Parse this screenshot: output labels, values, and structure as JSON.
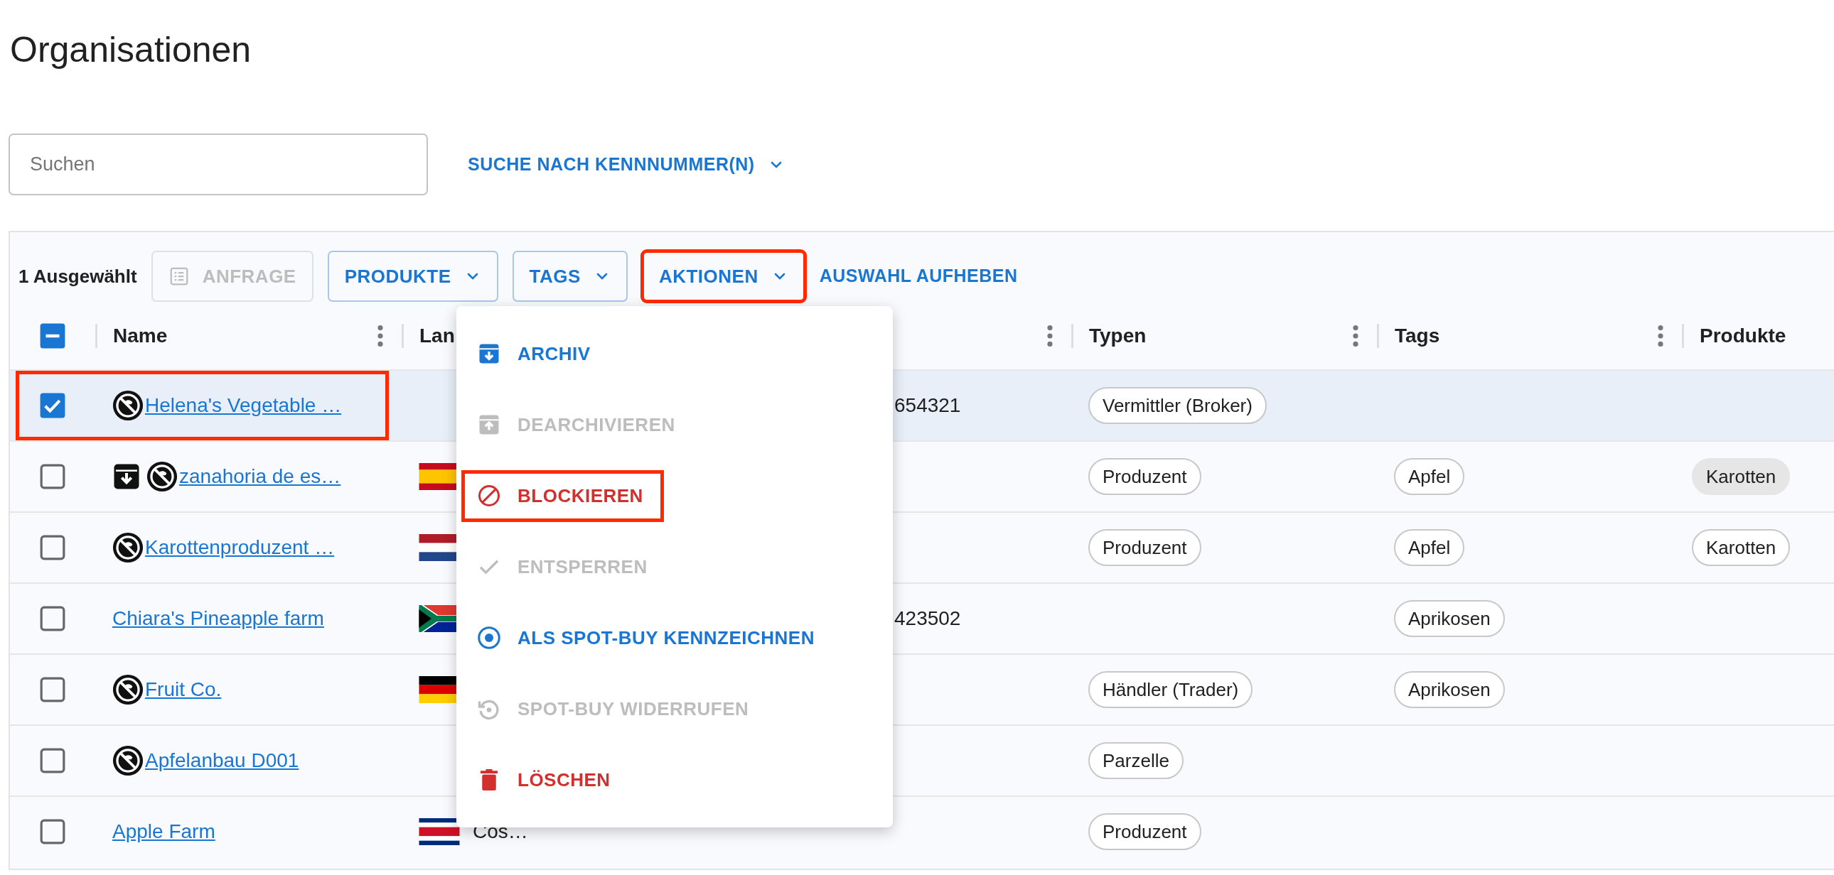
{
  "page": {
    "title": "Organisationen"
  },
  "search": {
    "placeholder": "Suchen",
    "id_search_link": "SUCHE NACH KENNNUMMER(N)"
  },
  "toolbar": {
    "selection_count": "1 Ausgewählt",
    "buttons": [
      {
        "label": "ANFRAGE",
        "kind": "request",
        "disabled": true,
        "highlighted": false
      },
      {
        "label": "PRODUKTE",
        "kind": "filter",
        "disabled": false,
        "highlighted": false
      },
      {
        "label": "TAGS",
        "kind": "filter",
        "disabled": false,
        "highlighted": false
      },
      {
        "label": "AKTIONEN",
        "kind": "actions",
        "disabled": false,
        "highlighted": true
      }
    ],
    "clear_selection": "AUSWAHL AUFHEBEN"
  },
  "table": {
    "header_checkbox": {
      "indeterminate": true
    },
    "columns": [
      {
        "label": "Name",
        "menu": true
      },
      {
        "label": "Lan",
        "menu": false
      },
      {
        "menu": true
      },
      {
        "label": "Typen",
        "menu": true
      },
      {
        "label": "Tags",
        "menu": true
      },
      {
        "label": "Produkte",
        "menu": false
      }
    ],
    "rows": [
      {
        "selected": true,
        "highlighted": true,
        "archived": false,
        "blocked": true,
        "name": "Helena's Vegetable …",
        "column_3": "654321",
        "typen": [
          "Vermittler (Broker)"
        ]
      },
      {
        "selected": false,
        "highlighted": false,
        "archived": true,
        "blocked": true,
        "name": "zanahoria de es…",
        "flag": {
          "kind": "spain"
        },
        "typen": [
          "Produzent"
        ],
        "tags": [
          "Apfel"
        ],
        "produkte": [
          {
            "label": "Karotten",
            "filled": true
          }
        ]
      },
      {
        "selected": false,
        "highlighted": false,
        "archived": false,
        "blocked": true,
        "name": "Karottenproduzent …",
        "flag": {
          "kind": "netherlands"
        },
        "typen": [
          "Produzent"
        ],
        "tags": [
          "Apfel"
        ],
        "produkte": [
          {
            "label": "Karotten",
            "filled": false
          }
        ]
      },
      {
        "selected": false,
        "highlighted": false,
        "archived": false,
        "blocked": false,
        "name": "Chiara's Pineapple farm",
        "flag": {
          "kind": "southafrica"
        },
        "column_3": "423502",
        "tags": [
          "Aprikosen"
        ]
      },
      {
        "selected": false,
        "highlighted": false,
        "archived": false,
        "blocked": true,
        "name": "Fruit Co.",
        "flag": {
          "kind": "germany"
        },
        "typen": [
          "Händler (Trader)"
        ],
        "tags": [
          "Aprikosen"
        ]
      },
      {
        "selected": false,
        "highlighted": false,
        "archived": false,
        "blocked": true,
        "name": "Apfelanbau D001",
        "typen": [
          "Parzelle"
        ]
      },
      {
        "selected": false,
        "highlighted": false,
        "archived": false,
        "blocked": false,
        "name": "Apple Farm",
        "flag": {
          "kind": "costarica"
        },
        "land": "Cos…",
        "typen": [
          "Produzent"
        ]
      }
    ]
  },
  "actions_menu": {
    "items": [
      {
        "label": "ARCHIV",
        "kind": "archive",
        "disabled": false,
        "highlighted": false
      },
      {
        "label": "DEARCHIVIEREN",
        "kind": "unarchive",
        "disabled": true,
        "highlighted": false
      },
      {
        "label": "BLOCKIEREN",
        "kind": "block",
        "disabled": false,
        "highlighted": true
      },
      {
        "label": "ENTSPERREN",
        "kind": "unblock",
        "disabled": true,
        "highlighted": false
      },
      {
        "label": "ALS SPOT-BUY KENNZEICHNEN",
        "kind": "spot-buy",
        "disabled": false,
        "highlighted": false
      },
      {
        "label": "SPOT-BUY WIDERRUFEN",
        "kind": "revoke",
        "disabled": true,
        "highlighted": false
      },
      {
        "label": "LÖSCHEN",
        "kind": "delete",
        "disabled": false,
        "highlighted": false
      }
    ]
  }
}
